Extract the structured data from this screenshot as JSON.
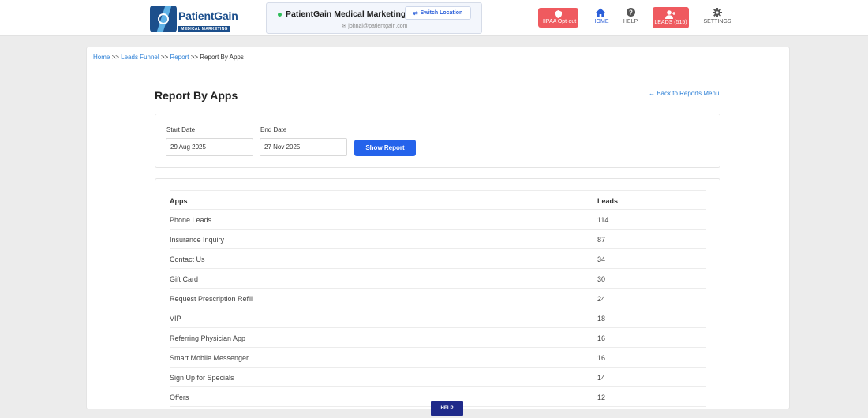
{
  "brand": {
    "name": "PatientGain",
    "tagline": "MEDICAL MARKETING"
  },
  "location": {
    "name": "PatientGain Medical Marketing",
    "switch_label": "Switch Location",
    "email": "johnal@patientgain.com"
  },
  "nav": {
    "hipaa_label": "HIPAA Opt-out",
    "home_label": "HOME",
    "help_label": "HELP",
    "leads_label": "LEADS (515)",
    "settings_label": "SETTINGS"
  },
  "breadcrumb": {
    "home": "Home",
    "leads_funnel": "Leads Funnel",
    "report": "Report",
    "current": "Report By Apps",
    "separator": ">>"
  },
  "page": {
    "title": "Report By Apps",
    "back_link": "← Back to Reports Menu"
  },
  "filters": {
    "start_label": "Start Date",
    "start_value": "29 Aug 2025",
    "end_label": "End Date",
    "end_value": "27 Nov 2025",
    "show_button": "Show Report"
  },
  "table": {
    "columns": [
      "Apps",
      "Leads"
    ],
    "rows": [
      {
        "app": "Phone Leads",
        "leads": "114"
      },
      {
        "app": "Insurance Inquiry",
        "leads": "87"
      },
      {
        "app": "Contact Us",
        "leads": "34"
      },
      {
        "app": "Gift Card",
        "leads": "30"
      },
      {
        "app": "Request Prescription Refill",
        "leads": "24"
      },
      {
        "app": "VIP",
        "leads": "18"
      },
      {
        "app": "Referring Physician App",
        "leads": "16"
      },
      {
        "app": "Smart Mobile Messenger",
        "leads": "16"
      },
      {
        "app": "Sign Up for Specials",
        "leads": "14"
      },
      {
        "app": "Offers",
        "leads": "12"
      }
    ]
  },
  "help_button": "HELP",
  "colors": {
    "primary": "#2563eb",
    "danger": "#ef5a5f",
    "brand": "#1c4f8c",
    "help": "#1f2a8a"
  }
}
